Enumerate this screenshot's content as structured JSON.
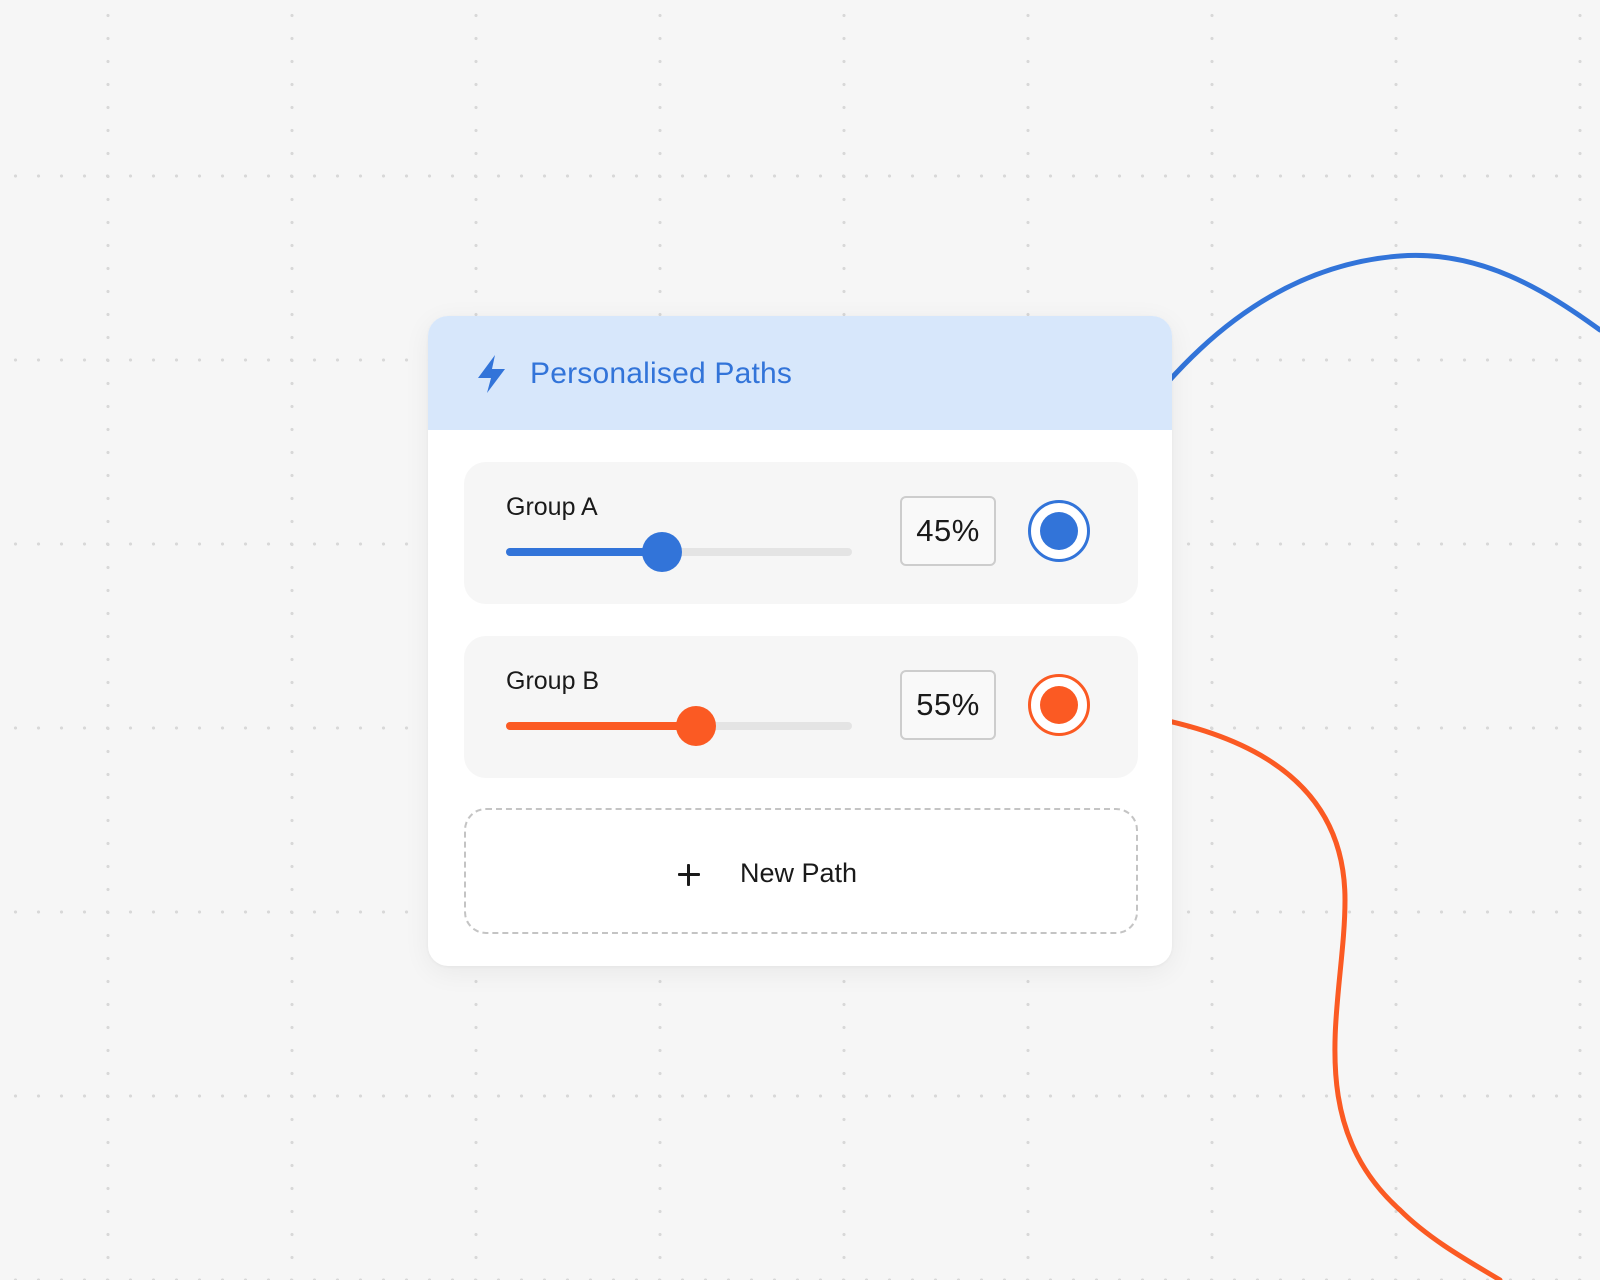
{
  "header": {
    "title": "Personalised Paths",
    "icon": "lightning-bolt-icon",
    "accent_color": "#3274d9",
    "background_color": "#d7e7fb"
  },
  "groups": [
    {
      "label": "Group A",
      "percent_label": "45%",
      "slider_value": 0.45,
      "color": "#3274d9"
    },
    {
      "label": "Group B",
      "percent_label": "55%",
      "slider_value": 0.55,
      "color": "#fb5a23"
    }
  ],
  "new_path": {
    "label": "New Path",
    "icon": "plus-icon"
  }
}
